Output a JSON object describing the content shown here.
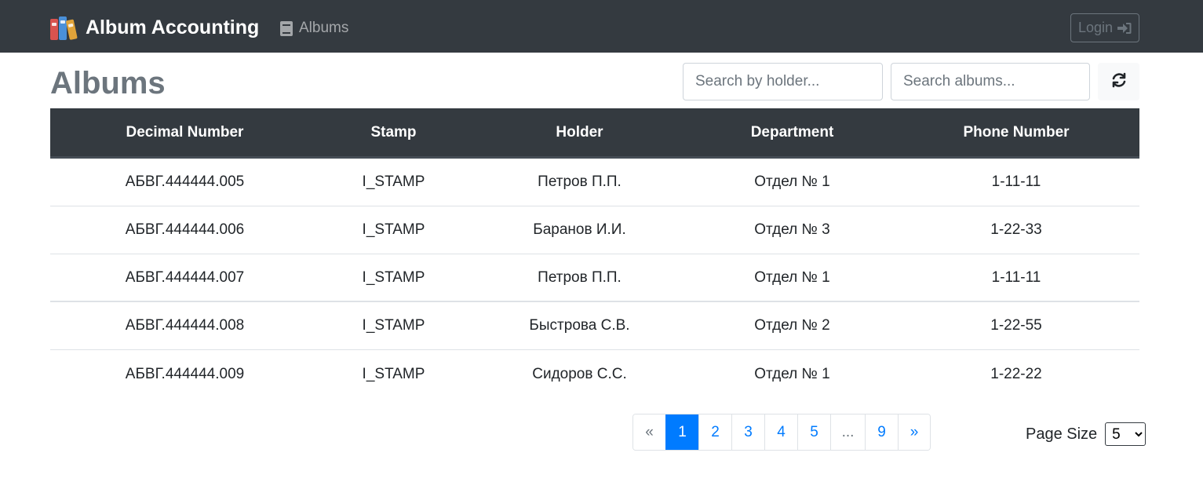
{
  "navbar": {
    "brand": "Album Accounting",
    "brand_icon": "binders-icon",
    "links": [
      {
        "label": "Albums",
        "icon": "book-icon"
      }
    ],
    "login_label": "Login",
    "login_icon": "sign-in-icon",
    "background": "#343a40"
  },
  "header": {
    "title": "Albums",
    "search_holder_placeholder": "Search by holder...",
    "search_albums_placeholder": "Search albums...",
    "refresh_icon": "refresh-icon"
  },
  "table": {
    "columns": [
      "Decimal Number",
      "Stamp",
      "Holder",
      "Department",
      "Phone Number"
    ],
    "rows": [
      [
        "АБВГ.444444.005",
        "I_STAMP",
        "Петров П.П.",
        "Отдел № 1",
        "1-11-11"
      ],
      [
        "АБВГ.444444.006",
        "I_STAMP",
        "Баранов И.И.",
        "Отдел № 3",
        "1-22-33"
      ],
      [
        "АБВГ.444444.007",
        "I_STAMP",
        "Петров П.П.",
        "Отдел № 1",
        "1-11-11"
      ],
      [
        "АБВГ.444444.008",
        "I_STAMP",
        "Быстрова С.В.",
        "Отдел № 2",
        "1-22-55"
      ],
      [
        "АБВГ.444444.009",
        "I_STAMP",
        "Сидоров С.С.",
        "Отдел № 1",
        "1-22-22"
      ]
    ]
  },
  "pagination": {
    "prev": "«",
    "pages": [
      "1",
      "2",
      "3",
      "4",
      "5"
    ],
    "ellipsis": "...",
    "last": "9",
    "next": "»",
    "active": "1",
    "active_color": "#007bff"
  },
  "page_size": {
    "label": "Page Size",
    "value": "5"
  }
}
